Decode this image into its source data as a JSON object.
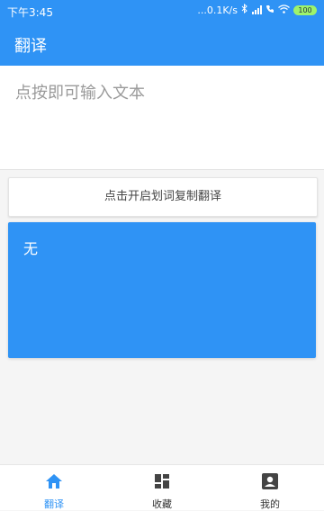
{
  "status_bar": {
    "time": "下午3:45",
    "net_speed": "...0.1K/s",
    "battery": "100"
  },
  "header": {
    "title": "翻译"
  },
  "input": {
    "placeholder": "点按即可输入文本",
    "value": ""
  },
  "copy_button": {
    "label": "点击开启划词复制翻译"
  },
  "result": {
    "text": "无"
  },
  "tabs": [
    {
      "label": "翻译",
      "icon": "home-icon",
      "active": true
    },
    {
      "label": "收藏",
      "icon": "dashboard-icon",
      "active": false
    },
    {
      "label": "我的",
      "icon": "account-box-icon",
      "active": false
    }
  ],
  "colors": {
    "primary": "#2f93f5",
    "background": "#f5f5f5",
    "battery": "#9ef36b"
  }
}
